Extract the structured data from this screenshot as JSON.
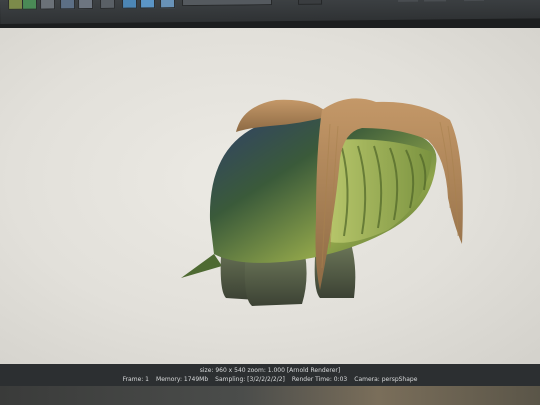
{
  "status": {
    "size_text": "size: 960 x 540 zoom: 1.000   [Arnold Renderer]",
    "frame": "Frame: 1",
    "memory": "Memory: 1749Mb",
    "sampling": "Sampling: [3/2/2/2/2/2]",
    "render_time": "Render Time: 0:03",
    "camera": "Camera: perspShape"
  }
}
